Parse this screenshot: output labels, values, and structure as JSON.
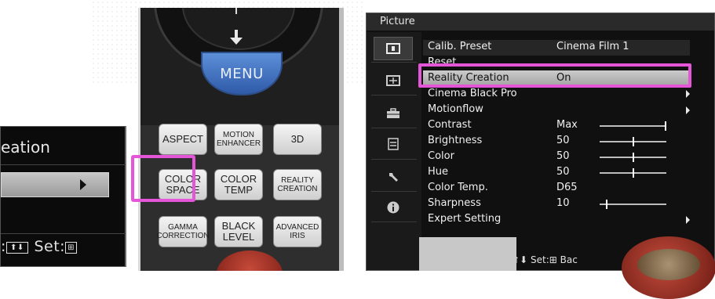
{
  "left_osd": {
    "title": "eation",
    "footer_prefix": ":",
    "footer_keys": "⬆⬇",
    "footer_set_label": "Set:",
    "footer_set_key": "⊞"
  },
  "remote": {
    "menu_label": "MENU",
    "buttons": [
      {
        "label": "ASPECT"
      },
      {
        "label": "MOTION\nENHANCER"
      },
      {
        "label": "3D"
      },
      {
        "label": "COLOR\nSPACE"
      },
      {
        "label": "COLOR\nTEMP"
      },
      {
        "label": "REALITY\nCREATION"
      },
      {
        "label": "GAMMA\nCORRECTION"
      },
      {
        "label": "BLACK\nLEVEL"
      },
      {
        "label": "ADVANCED\nIRIS"
      }
    ]
  },
  "osd": {
    "title": "Picture",
    "sidebar_icons": [
      "picture-icon",
      "screen-icon",
      "toolbox-icon",
      "function-icon",
      "wrench-icon",
      "info-icon"
    ],
    "rows": [
      {
        "label": "Calib. Preset",
        "value": "Cinema Film 1"
      },
      {
        "label": "Reset",
        "value": ""
      },
      {
        "label": "Reality Creation",
        "value": "On"
      },
      {
        "label": "Cinema Black Pro",
        "value": ""
      },
      {
        "label": "Motionflow",
        "value": ""
      },
      {
        "label": "Contrast",
        "value": "Max",
        "level": 1.0
      },
      {
        "label": "Brightness",
        "value": "50",
        "level": 0.5
      },
      {
        "label": "Color",
        "value": "50",
        "level": 0.5
      },
      {
        "label": "Hue",
        "value": "50",
        "level": 0.5
      },
      {
        "label": "Color Temp.",
        "value": "D65"
      },
      {
        "label": "Sharpness",
        "value": "10",
        "level": 0.1
      },
      {
        "label": "Expert Setting",
        "value": ""
      }
    ],
    "footer_keys": ":⬆⬇",
    "footer_set": "Set:⊞ Bac"
  },
  "colors": {
    "highlight": "#e455d8",
    "menu_blue": "#3f6fc0"
  }
}
